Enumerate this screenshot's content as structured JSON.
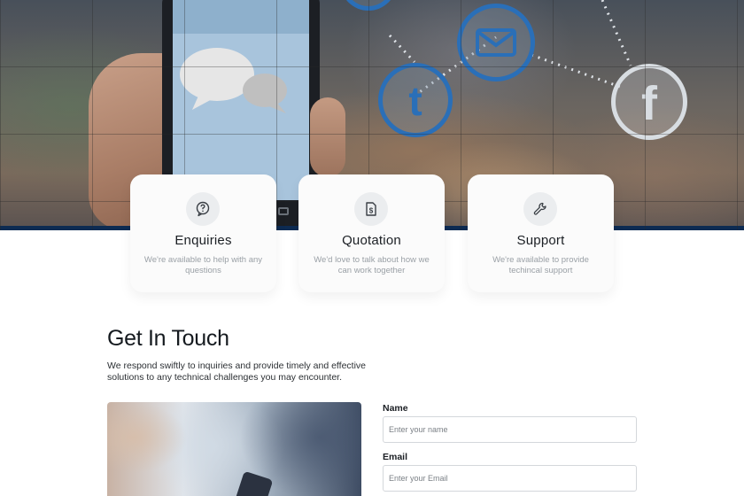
{
  "hero": {
    "icons": [
      "twitter-icon",
      "email-icon",
      "facebook-icon",
      "chat-bubbles-icon"
    ]
  },
  "features": [
    {
      "icon": "question-mark-icon",
      "title": "Enquiries",
      "description": "We're available to help with any questions"
    },
    {
      "icon": "document-dollar-icon",
      "title": "Quotation",
      "description": "We'd love to talk about how we can work together"
    },
    {
      "icon": "wrench-icon",
      "title": "Support",
      "description": "We're available to provide techincal support"
    }
  ],
  "contact": {
    "title": "Get In Touch",
    "description": "We respond swiftly to inquiries and provide timely and effective solutions to any technical challenges you may encounter.",
    "form": {
      "name_label": "Name",
      "name_placeholder": "Enter your name",
      "email_label": "Email",
      "email_placeholder": "Enter your Email"
    }
  },
  "colors": {
    "hero_band": "#0d2b52",
    "social_ring": "#2a6fb8",
    "card_background": "#fbfbfb",
    "text_dark": "#151a1f",
    "text_muted": "#9aa0a6"
  }
}
